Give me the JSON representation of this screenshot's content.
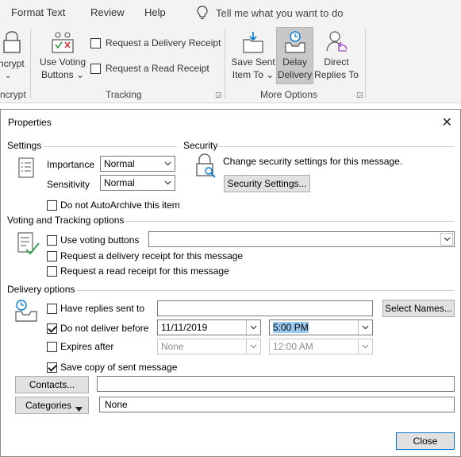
{
  "ribbon": {
    "tabs": [
      "Format Text",
      "Review",
      "Help"
    ],
    "tellme": "Tell me what you want to do",
    "encrypt_label": "ncrypt",
    "encrypt_group": "ncrypt",
    "use_voting": [
      "Use Voting",
      "Buttons ⌄"
    ],
    "delivery_receipt": "Request a Delivery Receipt",
    "read_receipt": "Request a Read Receipt",
    "tracking_group": "Tracking",
    "save_sent": [
      "Save Sent",
      "Item To ⌄"
    ],
    "delay_delivery": [
      "Delay",
      "Delivery"
    ],
    "direct_replies": [
      "Direct",
      "Replies To"
    ],
    "more_options_group": "More Options"
  },
  "dialog": {
    "title": "Properties",
    "close_glyph": "✕",
    "settings": {
      "title": "Settings",
      "importance_label": "Importance",
      "importance_value": "Normal",
      "sensitivity_label": "Sensitivity",
      "sensitivity_value": "Normal",
      "autoarchive_label": "Do not AutoArchive this item"
    },
    "security": {
      "title": "Security",
      "text": "Change security settings for this message.",
      "button": "Security Settings..."
    },
    "voting": {
      "title": "Voting and Tracking options",
      "use_voting_label": "Use voting buttons",
      "voting_value": "",
      "delivery_receipt_label": "Request a delivery receipt for this message",
      "read_receipt_label": "Request a read receipt for this message"
    },
    "delivery": {
      "title": "Delivery options",
      "replies_label": "Have replies sent to",
      "replies_value": "",
      "select_names": "Select Names...",
      "not_before_label": "Do not deliver before",
      "not_before_date": "11/11/2019",
      "not_before_time": "5:00 PM",
      "expires_label": "Expires after",
      "expires_date": "None",
      "expires_time": "12:00 AM",
      "save_copy_label": "Save copy of sent message"
    },
    "contacts_button": "Contacts...",
    "contacts_value": "",
    "categories_button": "Categories",
    "categories_value": "None",
    "close_button": "Close"
  }
}
